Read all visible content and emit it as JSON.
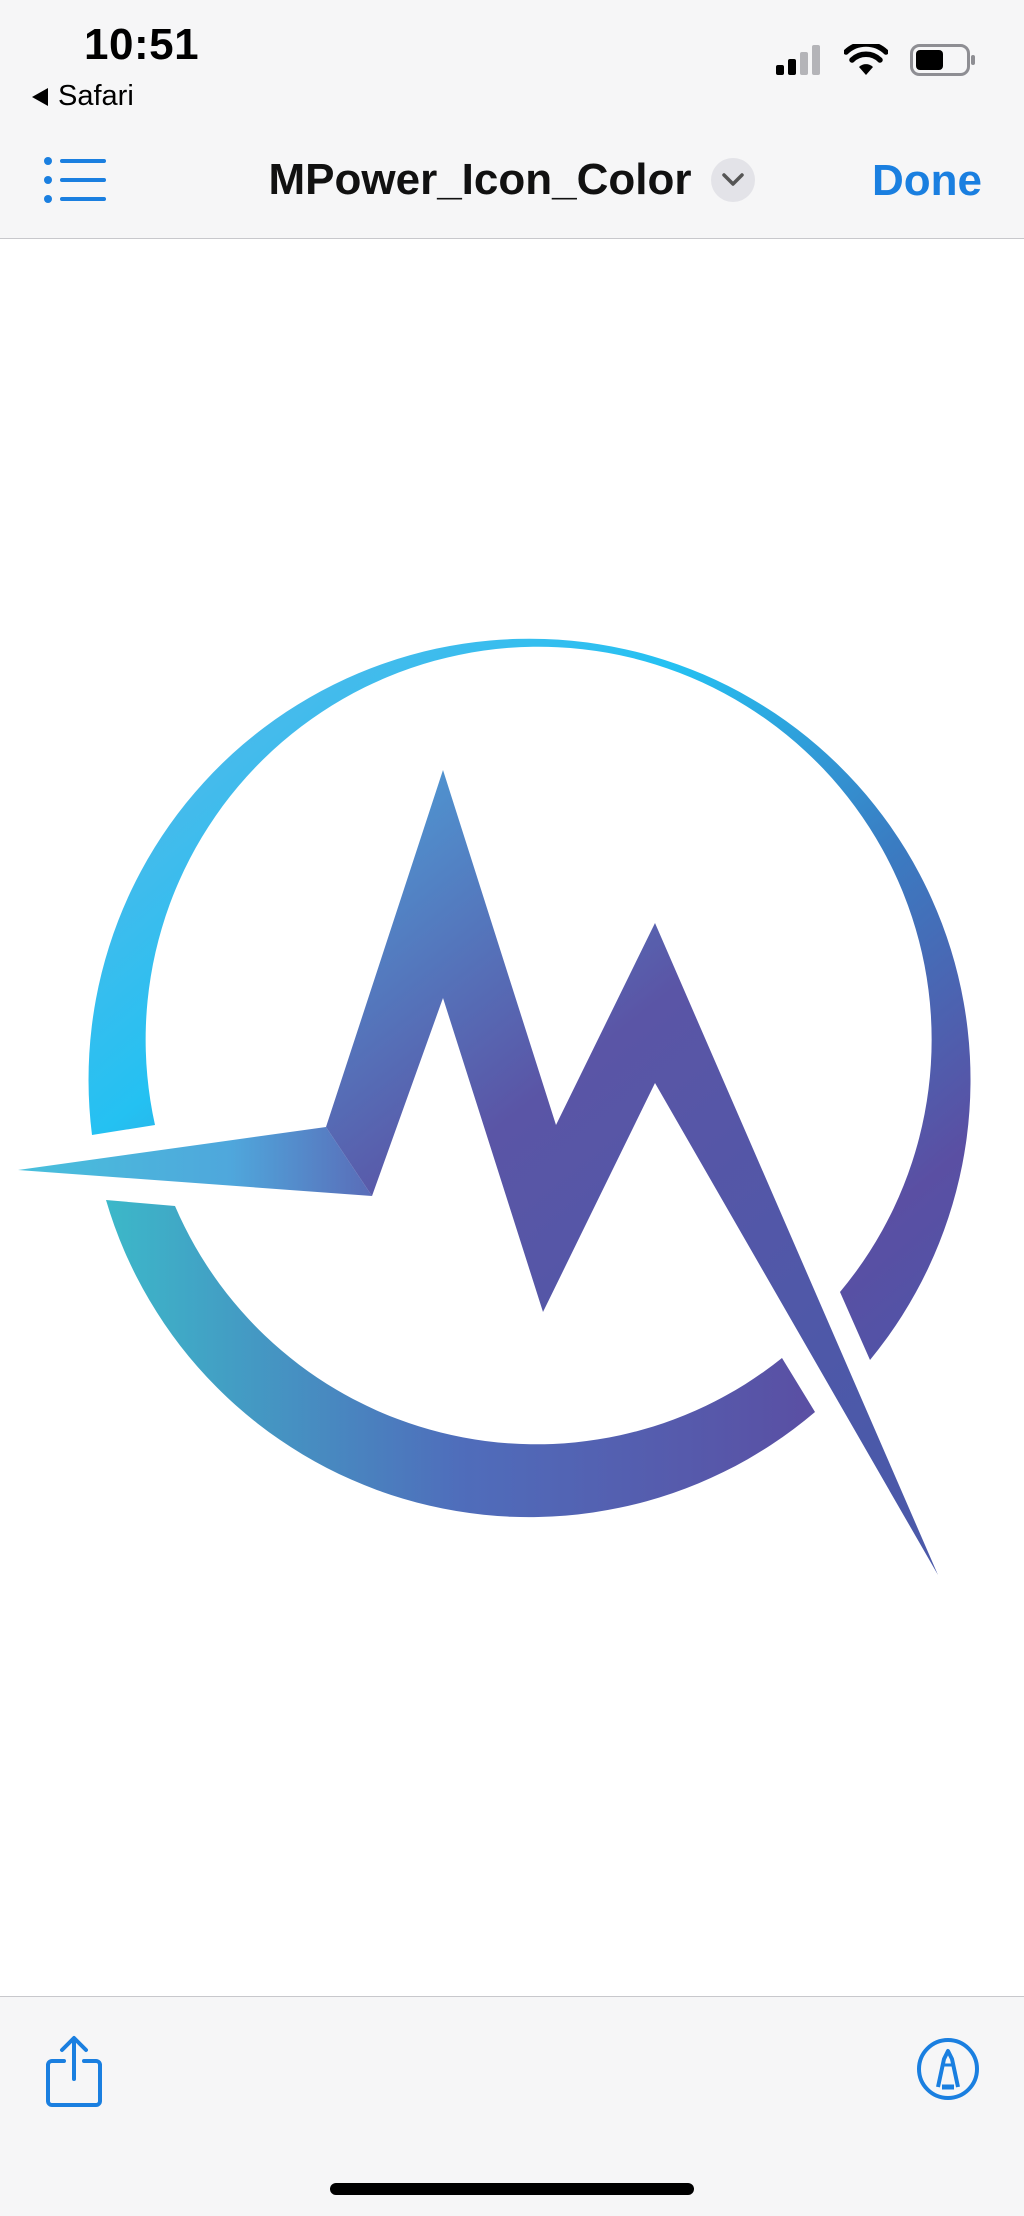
{
  "status_bar": {
    "time": "10:51",
    "back_app": "Safari",
    "icons": [
      "signal-icon",
      "wifi-icon",
      "battery-icon"
    ]
  },
  "header": {
    "title": "MPower_Icon_Color",
    "done_label": "Done",
    "left_icon": "list-icon",
    "title_icon": "chevron-down-icon"
  },
  "toolbar": {
    "left_icon": "share-icon",
    "right_icon": "markup-icon"
  },
  "colors": {
    "accent": "#1a7fe0",
    "chrome_bg": "#f6f6f7",
    "logo_cyan": "#1fc3f3",
    "logo_teal": "#3cb8c9",
    "logo_purple": "#5a4fa3",
    "logo_blue": "#3a74bd"
  }
}
